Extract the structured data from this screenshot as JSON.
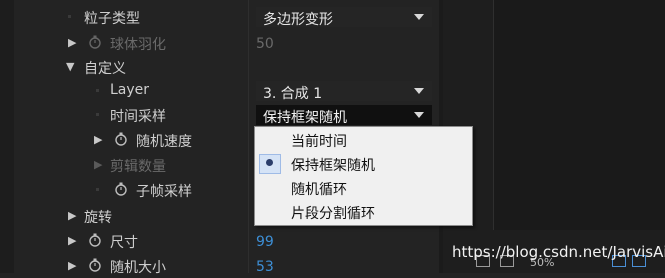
{
  "properties": [
    {
      "label": "粒子类型",
      "type": "dropdown",
      "value": "多边形变形"
    },
    {
      "label": "球体羽化",
      "value": "50",
      "enabled": false
    },
    {
      "label": "自定义"
    },
    {
      "label": "Layer",
      "type": "dropdown",
      "value": "3. 合成 1"
    },
    {
      "label": "时间采样",
      "type": "dropdown",
      "value": "保持框架随机"
    },
    {
      "label": "随机速度"
    },
    {
      "label": "剪辑数量",
      "enabled": false
    },
    {
      "label": "子帧采样"
    },
    {
      "label": "旋转"
    },
    {
      "label": "尺寸",
      "value": "99"
    },
    {
      "label": "随机大小",
      "value": "53"
    }
  ],
  "menu": {
    "items": [
      "当前时间",
      "保持框架随机",
      "随机循环",
      "片段分割循环"
    ],
    "selected_index": 1
  },
  "watermark": "https://blog.csdn.net/JarvisAi",
  "zoom": "50%",
  "icons": [
    "twirl-right-icon",
    "twirl-down-icon",
    "stopwatch-icon",
    "chevron-down-icon",
    "radio-selected-icon"
  ],
  "colors": {
    "panel_bg": "#232323",
    "value_blue": "#3d8fd6",
    "menu_bg": "#f0f0f0",
    "disabled_text": "#6a6a6a"
  }
}
